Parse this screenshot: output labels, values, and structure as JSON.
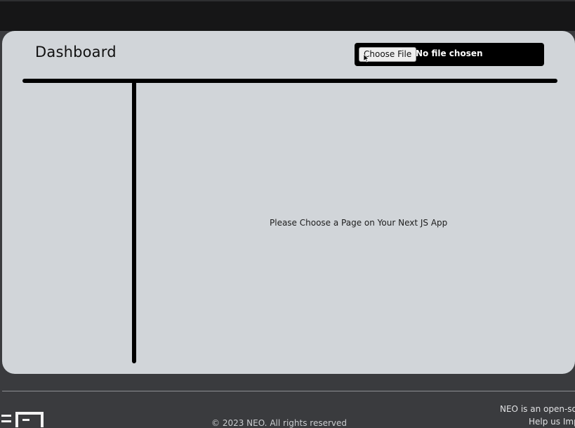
{
  "header": {
    "title": "Dashboard",
    "file_input": {
      "button_label": "Choose File",
      "status": "No file chosen"
    }
  },
  "main": {
    "message": "Please Choose a Page on Your Next JS App"
  },
  "footer": {
    "copyright": "© 2023 NEO. All rights reserved",
    "tagline": "NEO is an open-sou",
    "links": "Help us Imp"
  },
  "colors": {
    "page_background": "#3a3b3e",
    "top_bar": "#161617",
    "panel": "#d1d5d9",
    "divider_lines": "#000000"
  }
}
